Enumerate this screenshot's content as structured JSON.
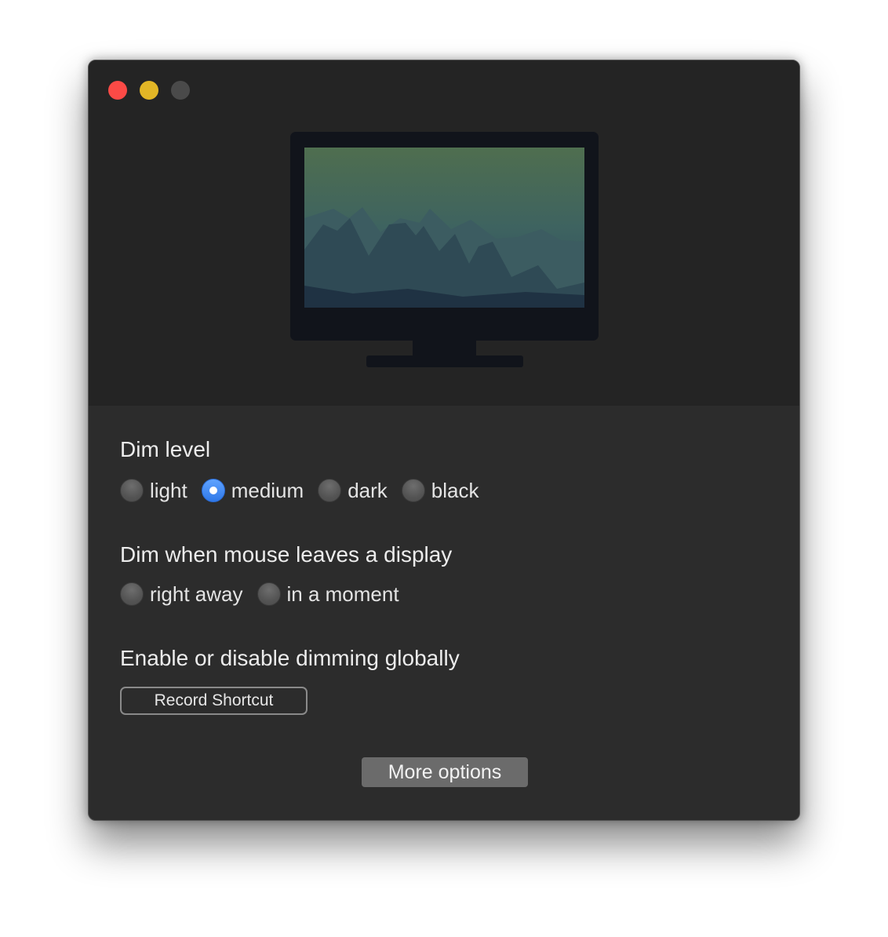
{
  "window": {
    "controls": [
      "close-icon",
      "minimize-icon",
      "zoom-icon"
    ]
  },
  "dim_level": {
    "title": "Dim level",
    "options": [
      {
        "label": "light",
        "checked": false
      },
      {
        "label": "medium",
        "checked": true
      },
      {
        "label": "dark",
        "checked": false
      },
      {
        "label": "black",
        "checked": false
      }
    ]
  },
  "mouse_leave": {
    "title": "Dim when mouse leaves a display",
    "options": [
      {
        "label": "right away",
        "checked": false
      },
      {
        "label": "in a moment",
        "checked": false
      }
    ]
  },
  "global_toggle": {
    "title": "Enable or disable dimming globally",
    "record_label": "Record Shortcut"
  },
  "footer": {
    "more_options_label": "More options"
  },
  "colors": {
    "window_bg": "#2c2c2c",
    "hero_bg": "#242424",
    "accent": "#3b82f0",
    "close": "#fc4a46",
    "minimize": "#e2b626"
  }
}
